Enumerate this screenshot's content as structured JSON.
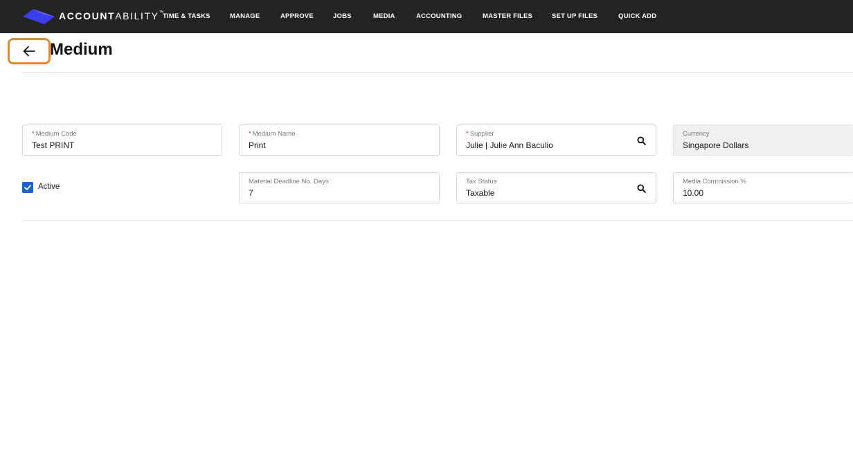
{
  "brand": {
    "name_bold": "ACCOUNT",
    "name_light": "ABILITY",
    "trademark": "™",
    "logo_color": "#3d3df0"
  },
  "nav": {
    "items": [
      {
        "label": "TIME & TASKS"
      },
      {
        "label": "MANAGE"
      },
      {
        "label": "APPROVE"
      },
      {
        "label": "JOBS"
      },
      {
        "label": "MEDIA"
      },
      {
        "label": "ACCOUNTING"
      },
      {
        "label": "MASTER FILES"
      },
      {
        "label": "SET UP FILES"
      },
      {
        "label": "QUICK ADD"
      }
    ]
  },
  "page": {
    "title": "Medium",
    "back_icon": "arrow-left-icon",
    "highlight_color": "#e08a35"
  },
  "form": {
    "required_marker": "*",
    "medium_code": {
      "label": "Medium Code",
      "value": "Test PRINT",
      "required": true
    },
    "medium_name": {
      "label": "Medium Name",
      "value": "Print",
      "required": true
    },
    "supplier": {
      "label": "Supplier",
      "value": "Julie | Julie Ann Baculio",
      "required": true,
      "icon": "search-icon"
    },
    "currency": {
      "label": "Currency",
      "value": "Singapore Dollars",
      "disabled": true
    },
    "active": {
      "label": "Active",
      "checked": true,
      "color": "#1e5fd6"
    },
    "material_deadline": {
      "label": "Material Deadline No. Days",
      "value": "7"
    },
    "tax_status": {
      "label": "Tax Status",
      "value": "Taxable",
      "icon": "search-icon"
    },
    "media_commission": {
      "label": "Media Commission %",
      "value": "10.00"
    }
  }
}
